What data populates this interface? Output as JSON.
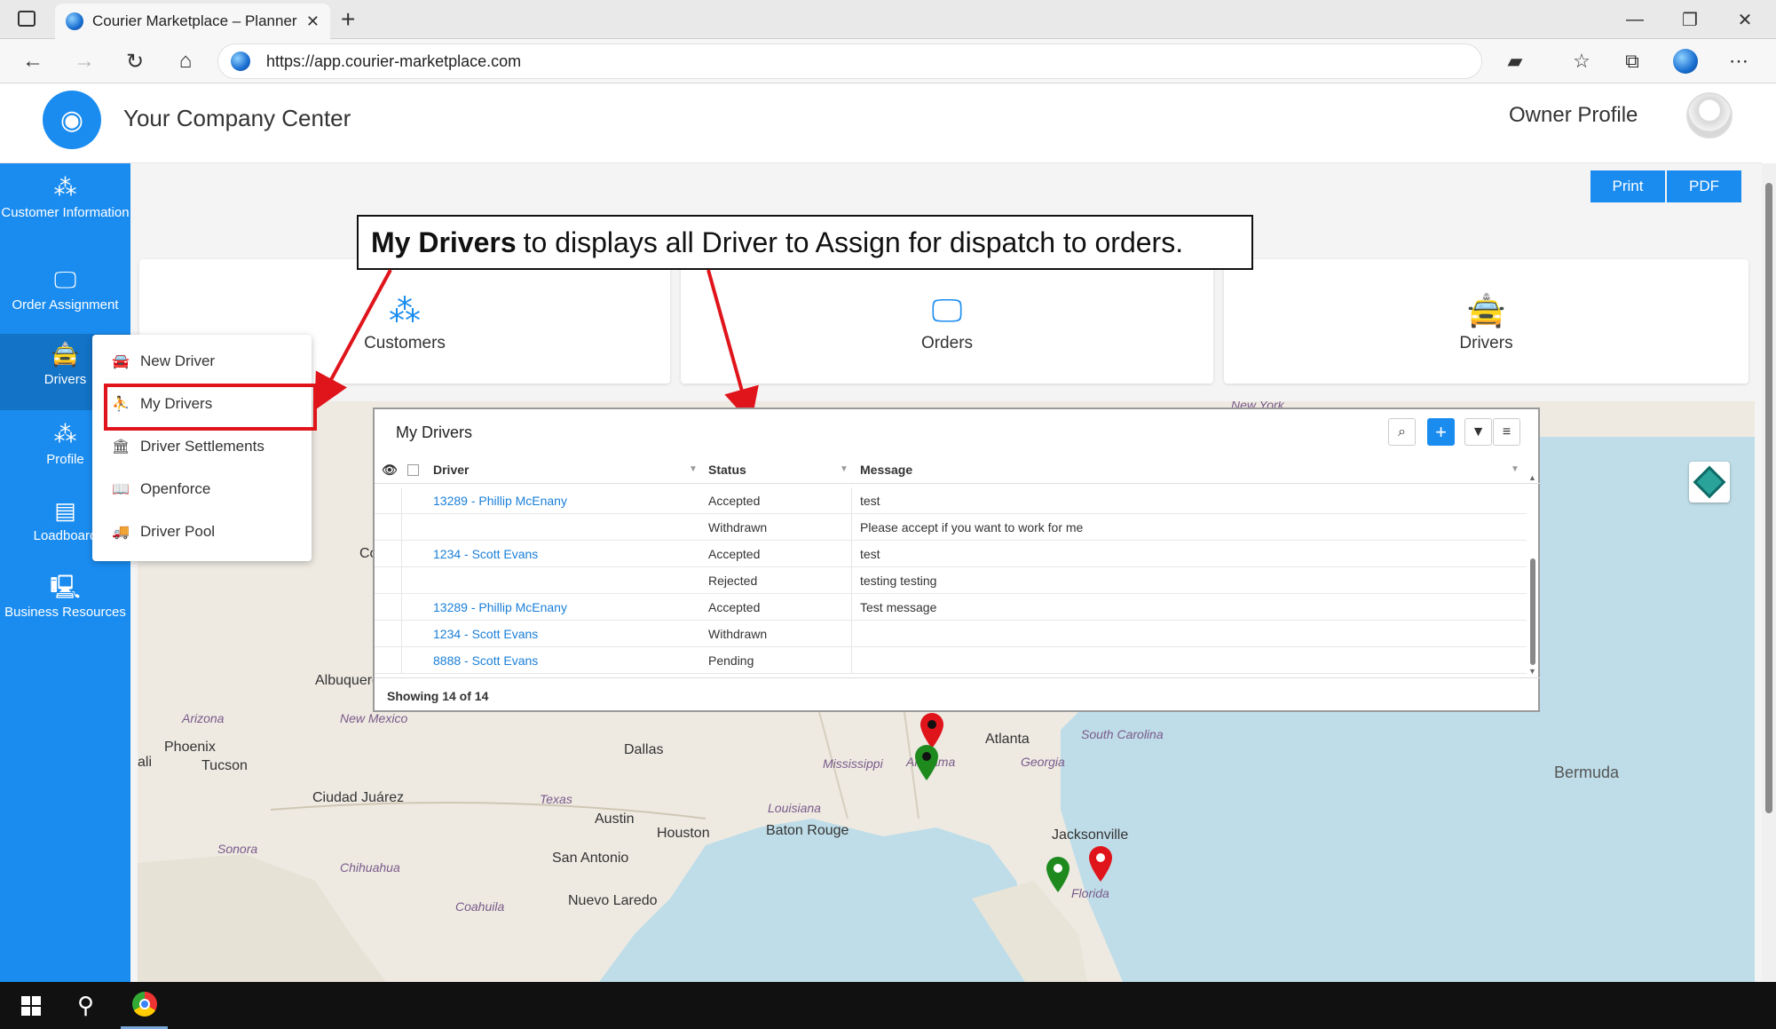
{
  "browser": {
    "tab_title": "Courier Marketplace – Planner",
    "tab_close": "✕",
    "new_tab": "+",
    "url": "https://app.courier-marketplace.com"
  },
  "header": {
    "company_title": "Your Company Center",
    "owner_profile": "Owner Profile"
  },
  "sidebar": {
    "items": [
      {
        "label": "Customer Information",
        "icon": "users-icon"
      },
      {
        "label": "Order Assignment",
        "icon": "monitor-icon"
      },
      {
        "label": "Drivers",
        "icon": "car-icon"
      },
      {
        "label": "Profile",
        "icon": "users-icon"
      },
      {
        "label": "Loadboard",
        "icon": "board-icon"
      },
      {
        "label": "Business Resources",
        "icon": "resources-icon"
      }
    ]
  },
  "toolbar": {
    "print_label": "Print",
    "pdf_label": "PDF"
  },
  "cards": [
    {
      "label": "Customers",
      "icon": "users-icon"
    },
    {
      "label": "Orders",
      "icon": "monitor-icon"
    },
    {
      "label": "Drivers",
      "icon": "car-icon"
    }
  ],
  "drivers_menu": {
    "items": [
      {
        "label": "New Driver",
        "icon": "car-icon"
      },
      {
        "label": "My Drivers",
        "icon": "drivers-icon"
      },
      {
        "label": "Driver Settlements",
        "icon": "bank-icon"
      },
      {
        "label": "Openforce",
        "icon": "book-icon"
      },
      {
        "label": "Driver Pool",
        "icon": "truck-icon"
      }
    ]
  },
  "callout": {
    "bold": "My Drivers",
    "rest": "to displays all Driver to Assign for dispatch to orders."
  },
  "grid": {
    "title": "My Drivers",
    "columns": [
      "Driver",
      "Status",
      "Message"
    ],
    "rows": [
      {
        "driver": "13289 - Phillip McEnany",
        "status": "Accepted",
        "message": "test"
      },
      {
        "driver": "",
        "status": "Withdrawn",
        "message": "Please accept if you want to work for me"
      },
      {
        "driver": "1234 - Scott Evans",
        "status": "Accepted",
        "message": "test"
      },
      {
        "driver": "",
        "status": "Rejected",
        "message": "testing testing"
      },
      {
        "driver": "13289 - Phillip McEnany",
        "status": "Accepted",
        "message": "Test message"
      },
      {
        "driver": "1234 - Scott Evans",
        "status": "Withdrawn",
        "message": ""
      },
      {
        "driver": "8888 - Scott Evans",
        "status": "Pending",
        "message": ""
      }
    ],
    "footer": "Showing 14 of 14"
  },
  "map": {
    "labels": [
      "New York",
      "Albuquerque",
      "Arizona",
      "New Mexico",
      "Phoenix",
      "Tucson",
      "Dallas",
      "Ciudad Juárez",
      "Texas",
      "Austin",
      "Houston",
      "San Antonio",
      "Sonora",
      "Chihuahua",
      "Coahuila",
      "Nuevo Laredo",
      "Louisiana",
      "Baton Rouge",
      "Mississippi",
      "Alabama",
      "Atlanta",
      "Georgia",
      "South Carolina",
      "Jacksonville",
      "Florida",
      "Bermuda",
      "Co",
      "ali"
    ],
    "pin_colors": {
      "accepted": "#1e8a1e",
      "pending": "#e0141b"
    }
  },
  "colors": {
    "brand": "#1a8cf0",
    "highlight": "#e0141b"
  }
}
